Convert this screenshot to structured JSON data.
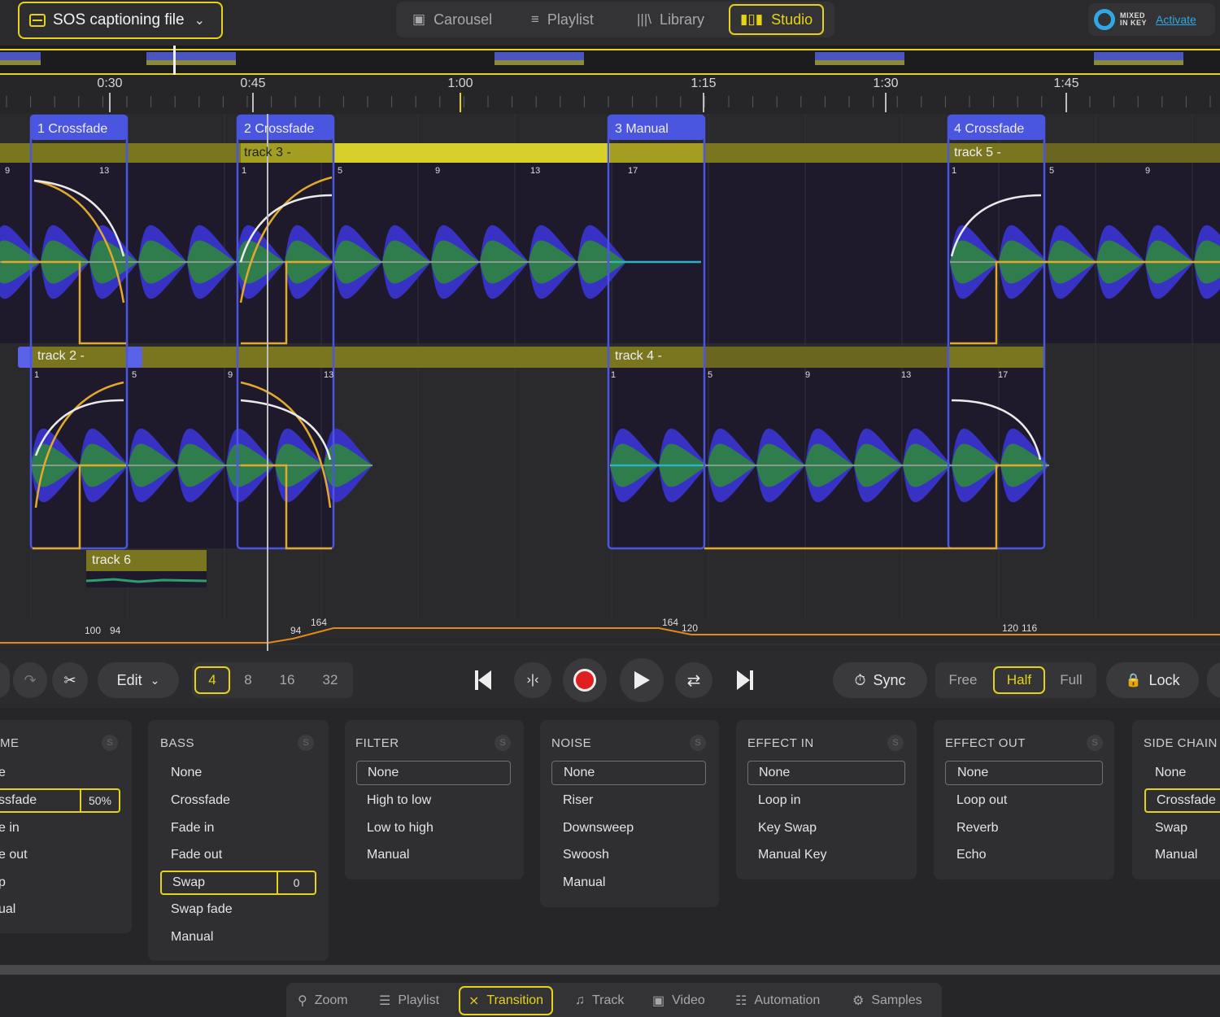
{
  "header": {
    "file_label": "SOS captioning file",
    "modes": [
      {
        "label": "Carousel",
        "icon": "carousel-icon"
      },
      {
        "label": "Playlist",
        "icon": "playlist-icon"
      },
      {
        "label": "Library",
        "icon": "library-icon"
      },
      {
        "label": "Studio",
        "icon": "studio-icon",
        "active": true
      }
    ],
    "brand": {
      "logo_text": "MIXED IN KEY",
      "activate": "Activate"
    }
  },
  "timeline": {
    "time_labels": [
      "0:30",
      "0:45",
      "1:00",
      "1:15",
      "1:30",
      "1:45"
    ],
    "transitions": [
      "1 Crossfade",
      "2 Crossfade",
      "3 Manual",
      "4 Crossfade"
    ],
    "tracks": [
      "track 3 -",
      "track 5 -",
      "track 2 -",
      "track 4 -",
      "track 6"
    ],
    "beat_markers": [
      "9",
      "13",
      "1",
      "5",
      "9",
      "13",
      "17",
      "1",
      "5",
      "9",
      "1",
      "5",
      "9",
      "13",
      "1",
      "5",
      "9",
      "13",
      "17"
    ],
    "bpm_labels": [
      "100",
      "94",
      "94",
      "164",
      "164",
      "120",
      "120",
      "116"
    ]
  },
  "transport": {
    "edit_label": "Edit",
    "loop_lengths": [
      "4",
      "8",
      "16",
      "32"
    ],
    "loop_selected": "4",
    "sync_label": "Sync",
    "modes": [
      "Free",
      "Half",
      "Full"
    ],
    "mode_selected": "Half",
    "lock_label": "Lock"
  },
  "panels": [
    {
      "title": "ME",
      "options": [
        "e",
        "ssfade",
        "e in",
        "e out",
        "p",
        "ual"
      ],
      "selected": "ssfade",
      "value": "50%"
    },
    {
      "title": "BASS",
      "options": [
        "None",
        "Crossfade",
        "Fade in",
        "Fade out",
        "Swap",
        "Swap fade",
        "Manual"
      ],
      "selected": "Swap",
      "value": "0"
    },
    {
      "title": "FILTER",
      "options": [
        "None",
        "High to low",
        "Low to high",
        "Manual"
      ],
      "selected": "None"
    },
    {
      "title": "NOISE",
      "options": [
        "None",
        "Riser",
        "Downsweep",
        "Swoosh",
        "Manual"
      ],
      "selected": "None"
    },
    {
      "title": "EFFECT IN",
      "options": [
        "None",
        "Loop in",
        "Key Swap",
        "Manual Key"
      ],
      "selected": "None"
    },
    {
      "title": "EFFECT OUT",
      "options": [
        "None",
        "Loop out",
        "Reverb",
        "Echo"
      ],
      "selected": "None"
    },
    {
      "title": "SIDE CHAIN",
      "options": [
        "None",
        "Crossfade",
        "Swap",
        "Manual"
      ],
      "selected": "Crossfade"
    }
  ],
  "bottom_nav": [
    {
      "label": "Zoom",
      "icon": "zoom-icon"
    },
    {
      "label": "Playlist",
      "icon": "list-icon"
    },
    {
      "label": "Transition",
      "icon": "transition-icon",
      "active": true
    },
    {
      "label": "Track",
      "icon": "music-note-icon"
    },
    {
      "label": "Video",
      "icon": "video-icon"
    },
    {
      "label": "Automation",
      "icon": "sliders-icon"
    },
    {
      "label": "Samples",
      "icon": "samples-icon"
    }
  ],
  "colors": {
    "accent": "#e6d21a",
    "transition_blue": "#4a55e0",
    "wave_blue": "#3a34c8",
    "wave_green": "#2f7d4c",
    "bpm_line": "#e08a1a",
    "brand_blue": "#2fa8e4"
  }
}
